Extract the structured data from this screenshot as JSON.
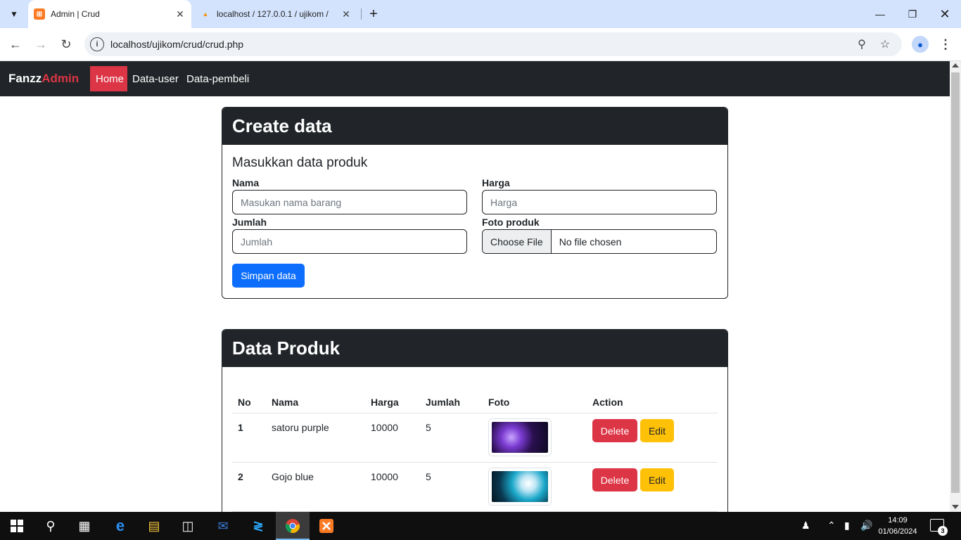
{
  "browser": {
    "tabs": [
      {
        "title": "Admin | Crud",
        "favicon": "xampp-icon",
        "active": true
      },
      {
        "title": "localhost / 127.0.0.1 / ujikom / ",
        "favicon": "phpmyadmin-icon",
        "active": false
      }
    ],
    "url": "localhost/ujikom/crud/crud.php"
  },
  "navbar": {
    "brand_main": "Fanzz",
    "brand_accent": "Admin",
    "items": [
      {
        "label": "Home",
        "active": true
      },
      {
        "label": "Data-user",
        "active": false
      },
      {
        "label": "Data-pembeli",
        "active": false
      }
    ]
  },
  "create_card": {
    "title": "Create data",
    "subtitle": "Masukkan data produk",
    "fields": {
      "nama": {
        "label": "Nama",
        "placeholder": "Masukan nama barang"
      },
      "harga": {
        "label": "Harga",
        "placeholder": "Harga"
      },
      "jumlah": {
        "label": "Jumlah",
        "placeholder": "Jumlah"
      },
      "foto": {
        "label": "Foto produk",
        "button": "Choose File",
        "status": "No file chosen"
      }
    },
    "submit_label": "Simpan data"
  },
  "data_card": {
    "title": "Data Produk",
    "columns": [
      "No",
      "Nama",
      "Harga",
      "Jumlah",
      "Foto",
      "Action"
    ],
    "rows": [
      {
        "no": "1",
        "nama": "satoru purple",
        "harga": "10000",
        "jumlah": "5",
        "foto": "satoru-purple-image"
      },
      {
        "no": "2",
        "nama": "Gojo blue",
        "harga": "10000",
        "jumlah": "5",
        "foto": "gojo-blue-image"
      }
    ],
    "delete_label": "Delete",
    "edit_label": "Edit"
  },
  "taskbar": {
    "time": "14:09",
    "date": "01/06/2024",
    "notifications": "3"
  },
  "colors": {
    "dark": "#212529",
    "danger": "#dc3545",
    "primary": "#0d6efd",
    "warning": "#ffc107",
    "tabstrip": "#d3e3fd"
  }
}
